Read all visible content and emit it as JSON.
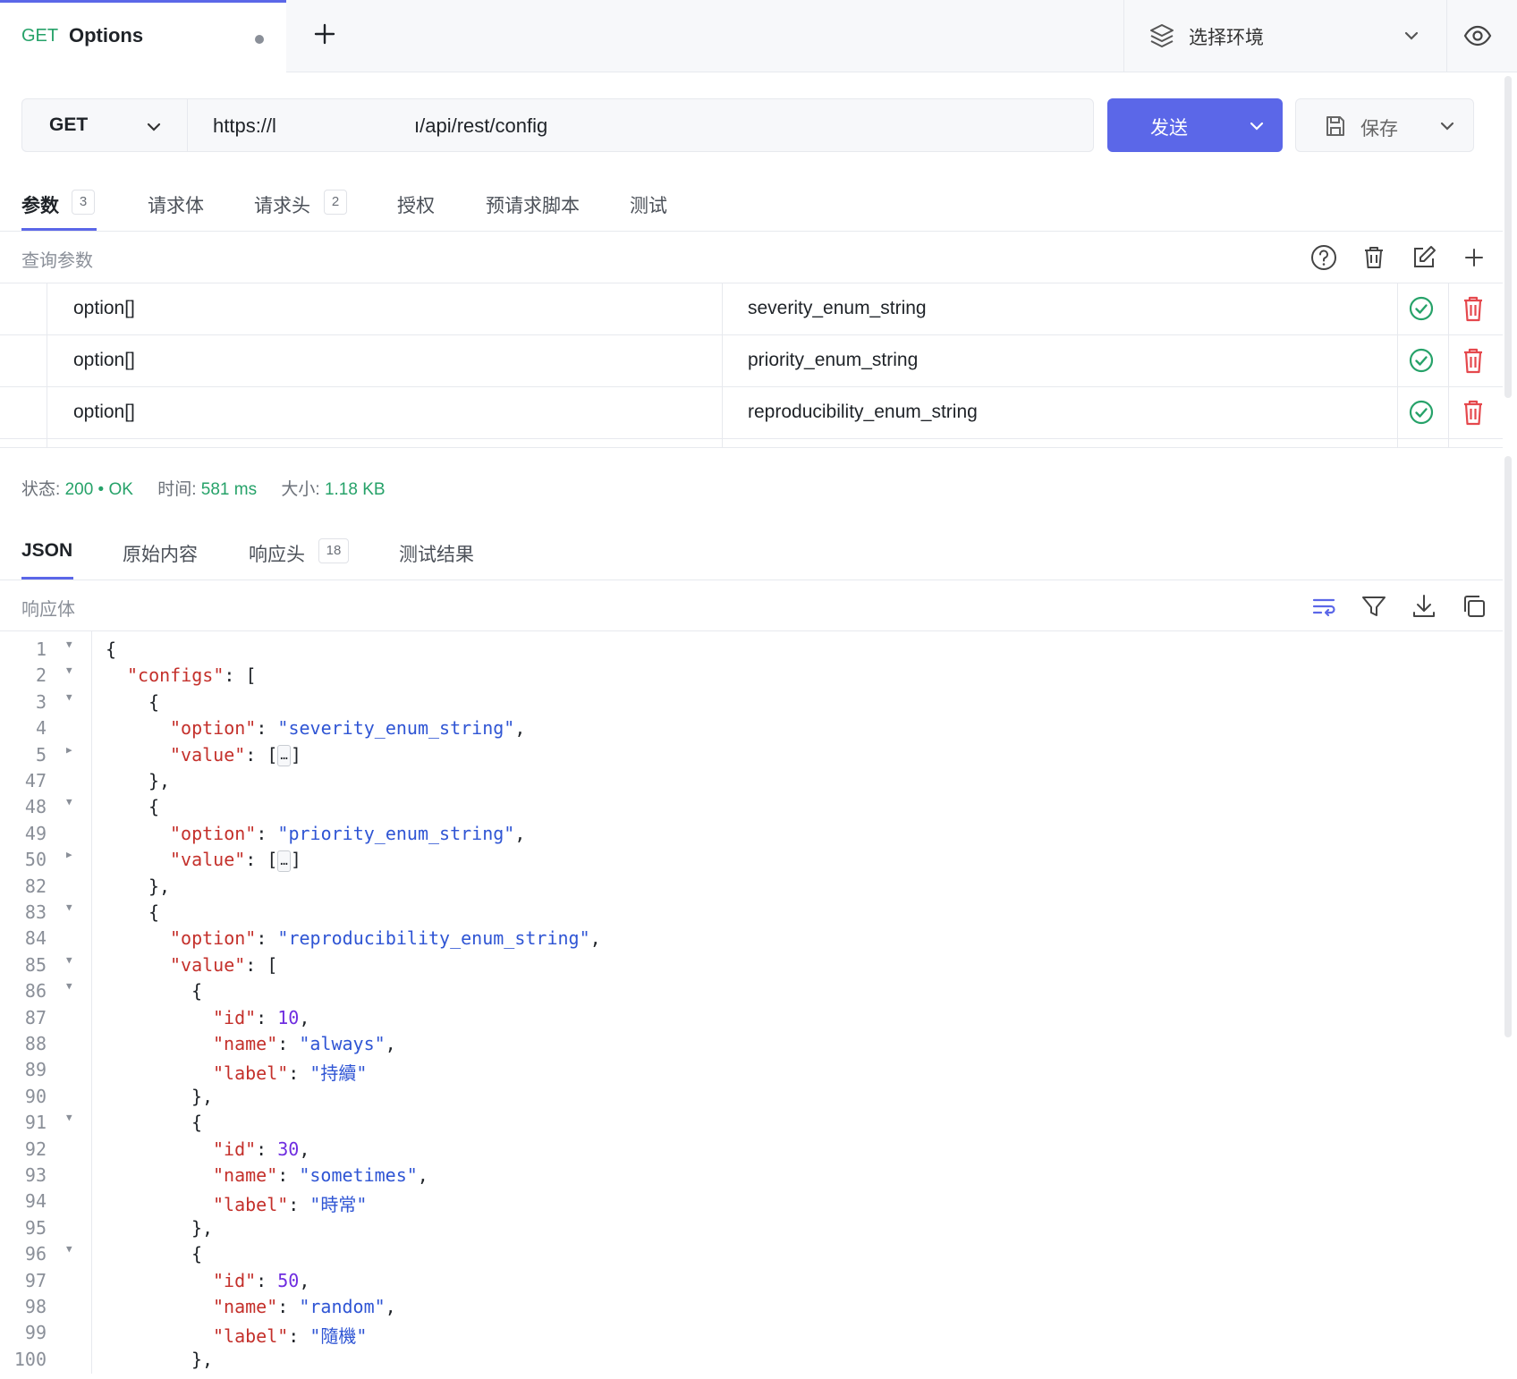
{
  "request_tab": {
    "method": "GET",
    "name": "Options"
  },
  "environment": {
    "label": "选择环境"
  },
  "url_bar": {
    "method": "GET",
    "url_prefix": "https://l",
    "url_suffix": "ı/api/rest/config",
    "send_label": "发送",
    "save_label": "保存"
  },
  "request_tabs": [
    {
      "label": "参数",
      "badge": "3"
    },
    {
      "label": "请求体"
    },
    {
      "label": "请求头",
      "badge": "2"
    },
    {
      "label": "授权"
    },
    {
      "label": "预请求脚本"
    },
    {
      "label": "测试"
    }
  ],
  "params_section": {
    "title": "查询参数"
  },
  "params": [
    {
      "key": "option[]",
      "value": "severity_enum_string"
    },
    {
      "key": "option[]",
      "value": "priority_enum_string"
    },
    {
      "key": "option[]",
      "value": "reproducibility_enum_string"
    }
  ],
  "status": {
    "status_label": "状态:",
    "status_code": "200",
    "status_sep": "•",
    "status_text": "OK",
    "time_label": "时间:",
    "time_value": "581 ms",
    "size_label": "大小:",
    "size_value": "1.18 KB"
  },
  "response_tabs": [
    {
      "label": "JSON"
    },
    {
      "label": "原始内容"
    },
    {
      "label": "响应头",
      "badge": "18"
    },
    {
      "label": "测试结果"
    }
  ],
  "response_section": {
    "title": "响应体"
  },
  "colors": {
    "accent": "#5b67e8",
    "success": "#26a269",
    "danger": "#e5484d",
    "json_key": "#c4302b",
    "json_string": "#2f55d4",
    "json_number": "#6f2de0"
  },
  "code_lines": [
    {
      "n": "1",
      "fold": "down",
      "indent": 0,
      "parts": [
        [
          "p",
          "{"
        ]
      ]
    },
    {
      "n": "2",
      "fold": "down",
      "indent": 1,
      "parts": [
        [
          "k",
          "\"configs\""
        ],
        [
          "p",
          ": ["
        ]
      ]
    },
    {
      "n": "3",
      "fold": "down",
      "indent": 2,
      "parts": [
        [
          "p",
          "{"
        ]
      ]
    },
    {
      "n": "4",
      "fold": "",
      "indent": 3,
      "parts": [
        [
          "k",
          "\"option\""
        ],
        [
          "p",
          ": "
        ],
        [
          "s",
          "\"severity_enum_string\""
        ],
        [
          "p",
          ","
        ]
      ]
    },
    {
      "n": "5",
      "fold": "right",
      "indent": 3,
      "parts": [
        [
          "k",
          "\"value\""
        ],
        [
          "p",
          ": ["
        ],
        [
          "e",
          "…"
        ],
        [
          "p",
          "]"
        ]
      ]
    },
    {
      "n": "47",
      "fold": "",
      "indent": 2,
      "parts": [
        [
          "p",
          "},"
        ]
      ]
    },
    {
      "n": "48",
      "fold": "down",
      "indent": 2,
      "parts": [
        [
          "p",
          "{"
        ]
      ]
    },
    {
      "n": "49",
      "fold": "",
      "indent": 3,
      "parts": [
        [
          "k",
          "\"option\""
        ],
        [
          "p",
          ": "
        ],
        [
          "s",
          "\"priority_enum_string\""
        ],
        [
          "p",
          ","
        ]
      ]
    },
    {
      "n": "50",
      "fold": "right",
      "indent": 3,
      "parts": [
        [
          "k",
          "\"value\""
        ],
        [
          "p",
          ": ["
        ],
        [
          "e",
          "…"
        ],
        [
          "p",
          "]"
        ]
      ]
    },
    {
      "n": "82",
      "fold": "",
      "indent": 2,
      "parts": [
        [
          "p",
          "},"
        ]
      ]
    },
    {
      "n": "83",
      "fold": "down",
      "indent": 2,
      "parts": [
        [
          "p",
          "{"
        ]
      ]
    },
    {
      "n": "84",
      "fold": "",
      "indent": 3,
      "parts": [
        [
          "k",
          "\"option\""
        ],
        [
          "p",
          ": "
        ],
        [
          "s",
          "\"reproducibility_enum_string\""
        ],
        [
          "p",
          ","
        ]
      ]
    },
    {
      "n": "85",
      "fold": "down",
      "indent": 3,
      "parts": [
        [
          "k",
          "\"value\""
        ],
        [
          "p",
          ": ["
        ]
      ]
    },
    {
      "n": "86",
      "fold": "down",
      "indent": 4,
      "parts": [
        [
          "p",
          "{"
        ]
      ]
    },
    {
      "n": "87",
      "fold": "",
      "indent": 5,
      "parts": [
        [
          "k",
          "\"id\""
        ],
        [
          "p",
          ": "
        ],
        [
          "n",
          "10"
        ],
        [
          "p",
          ","
        ]
      ]
    },
    {
      "n": "88",
      "fold": "",
      "indent": 5,
      "parts": [
        [
          "k",
          "\"name\""
        ],
        [
          "p",
          ": "
        ],
        [
          "s",
          "\"always\""
        ],
        [
          "p",
          ","
        ]
      ]
    },
    {
      "n": "89",
      "fold": "",
      "indent": 5,
      "parts": [
        [
          "k",
          "\"label\""
        ],
        [
          "p",
          ": "
        ],
        [
          "s",
          "\"持續\""
        ]
      ]
    },
    {
      "n": "90",
      "fold": "",
      "indent": 4,
      "parts": [
        [
          "p",
          "},"
        ]
      ]
    },
    {
      "n": "91",
      "fold": "down",
      "indent": 4,
      "parts": [
        [
          "p",
          "{"
        ]
      ]
    },
    {
      "n": "92",
      "fold": "",
      "indent": 5,
      "parts": [
        [
          "k",
          "\"id\""
        ],
        [
          "p",
          ": "
        ],
        [
          "n",
          "30"
        ],
        [
          "p",
          ","
        ]
      ]
    },
    {
      "n": "93",
      "fold": "",
      "indent": 5,
      "parts": [
        [
          "k",
          "\"name\""
        ],
        [
          "p",
          ": "
        ],
        [
          "s",
          "\"sometimes\""
        ],
        [
          "p",
          ","
        ]
      ]
    },
    {
      "n": "94",
      "fold": "",
      "indent": 5,
      "parts": [
        [
          "k",
          "\"label\""
        ],
        [
          "p",
          ": "
        ],
        [
          "s",
          "\"時常\""
        ]
      ]
    },
    {
      "n": "95",
      "fold": "",
      "indent": 4,
      "parts": [
        [
          "p",
          "},"
        ]
      ]
    },
    {
      "n": "96",
      "fold": "down",
      "indent": 4,
      "parts": [
        [
          "p",
          "{"
        ]
      ]
    },
    {
      "n": "97",
      "fold": "",
      "indent": 5,
      "parts": [
        [
          "k",
          "\"id\""
        ],
        [
          "p",
          ": "
        ],
        [
          "n",
          "50"
        ],
        [
          "p",
          ","
        ]
      ]
    },
    {
      "n": "98",
      "fold": "",
      "indent": 5,
      "parts": [
        [
          "k",
          "\"name\""
        ],
        [
          "p",
          ": "
        ],
        [
          "s",
          "\"random\""
        ],
        [
          "p",
          ","
        ]
      ]
    },
    {
      "n": "99",
      "fold": "",
      "indent": 5,
      "parts": [
        [
          "k",
          "\"label\""
        ],
        [
          "p",
          ": "
        ],
        [
          "s",
          "\"隨機\""
        ]
      ]
    },
    {
      "n": "100",
      "fold": "",
      "indent": 4,
      "parts": [
        [
          "p",
          "},"
        ]
      ]
    }
  ]
}
